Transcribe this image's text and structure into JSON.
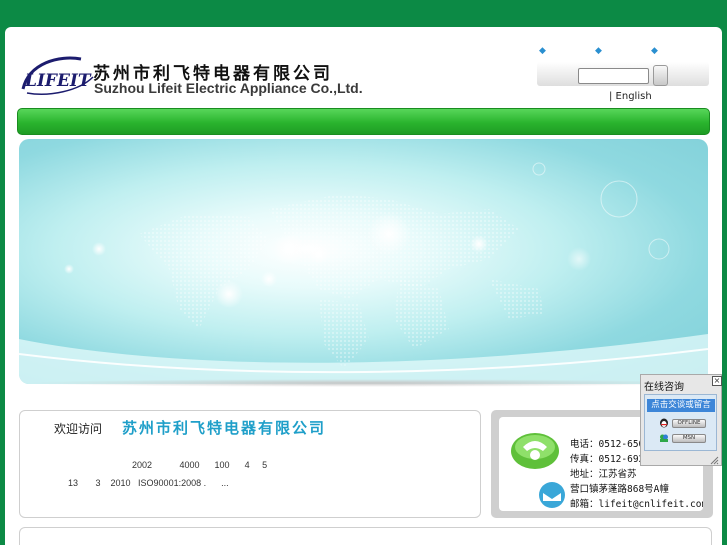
{
  "header": {
    "logo_text": "LIFEIT",
    "company_cn": "苏州市利飞特电器有限公司",
    "company_en": "Suzhou Lifeit Electric Appliance Co.,Ltd.",
    "top_link_symbols": [
      "◆",
      "◆",
      "◆"
    ],
    "search_value": "",
    "search_button_label": "",
    "language": "| English"
  },
  "welcome": {
    "prefix": "欢迎访问",
    "company_name": "苏州市利飞特电器有限公司",
    "intro_line1": "2002           4000      100      4     5",
    "intro_line2": "13       3    2010   ISO90001:2008 .      ..."
  },
  "contact": {
    "phone": "电话：0512-650",
    "fax": "传真：0512-692",
    "address_line1": "地址：江苏省苏",
    "address_line2": "营口镇茅蓬路868号A幢",
    "email": "邮箱：lifeit@cnlifeit.com"
  },
  "chat": {
    "title": "在线咨询",
    "close_label": "×",
    "message_button": "点击交谈或留言",
    "status_1": "OFFLINE",
    "status_2": "MSN"
  },
  "colors": {
    "page_bg": "#0c8a45",
    "nav_green": "#2ab42e",
    "accent_blue": "#1f9fc9"
  }
}
